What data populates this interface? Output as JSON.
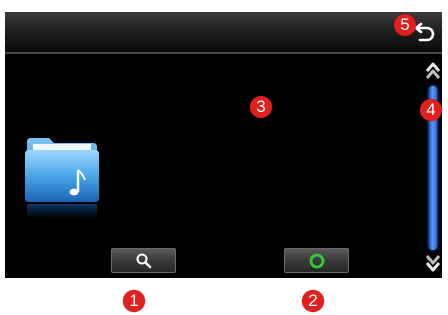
{
  "icons": {
    "back": "return-arrow-icon",
    "folder": "music-folder-icon",
    "search": "magnifier-icon",
    "ok": "green-circle-icon",
    "scroll_up": "chevron-up-icon",
    "scroll_down": "chevron-down-icon"
  },
  "colors": {
    "screen_background": "#000000",
    "callout": "#e01f1f",
    "scroll_thumb": "#3b7cff",
    "ok_ring": "#33cc33",
    "folder": "#3d9be0"
  },
  "scrollbar": {
    "thumb_fraction": 1.0
  },
  "callouts": [
    {
      "label": "1"
    },
    {
      "label": "2"
    },
    {
      "label": "3"
    },
    {
      "label": "4"
    },
    {
      "label": "5"
    }
  ]
}
